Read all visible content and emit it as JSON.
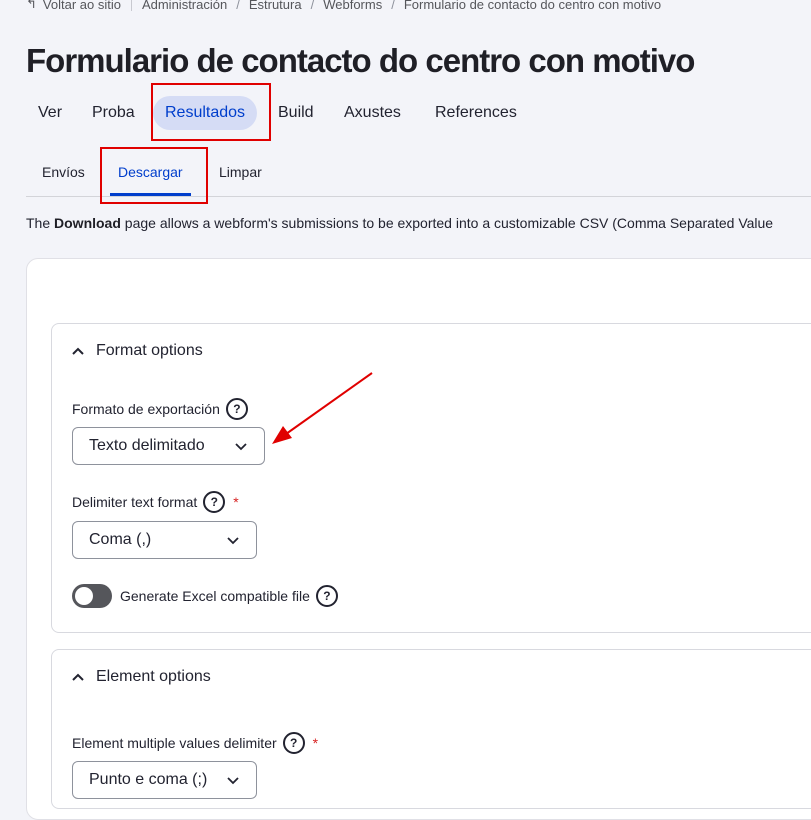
{
  "breadcrumb": {
    "back": "Voltar ao sitio",
    "items": [
      "Administración",
      "Estrutura",
      "Webforms",
      "Formulario de contacto do centro con motivo"
    ]
  },
  "page_title": "Formulario de contacto do centro con motivo",
  "primary_tabs": [
    "Ver",
    "Proba",
    "Resultados",
    "Build",
    "Axustes",
    "References"
  ],
  "secondary_tabs": [
    "Envíos",
    "Descargar",
    "Limpar"
  ],
  "description": {
    "prefix": "The ",
    "bold": "Download",
    "suffix": " page allows a webform's submissions to be exported into a customizable CSV (Comma Separated Value"
  },
  "format_options": {
    "legend": "Format options",
    "export_format_label": "Formato de exportación",
    "export_format_value": "Texto delimitado",
    "delimiter_label": "Delimiter text format",
    "delimiter_value": "Coma (,)",
    "excel_label": "Generate Excel compatible file",
    "excel_enabled": false
  },
  "element_options": {
    "legend": "Element options",
    "multiple_delimiter_label": "Element multiple values delimiter",
    "multiple_delimiter_value": "Punto e coma (;)"
  },
  "icons": {
    "help": "?",
    "required": "*",
    "back": "↰"
  },
  "colors": {
    "accent": "#003ecc",
    "active_tab_bg": "#d5dcf5",
    "annotation": "#e00000"
  }
}
